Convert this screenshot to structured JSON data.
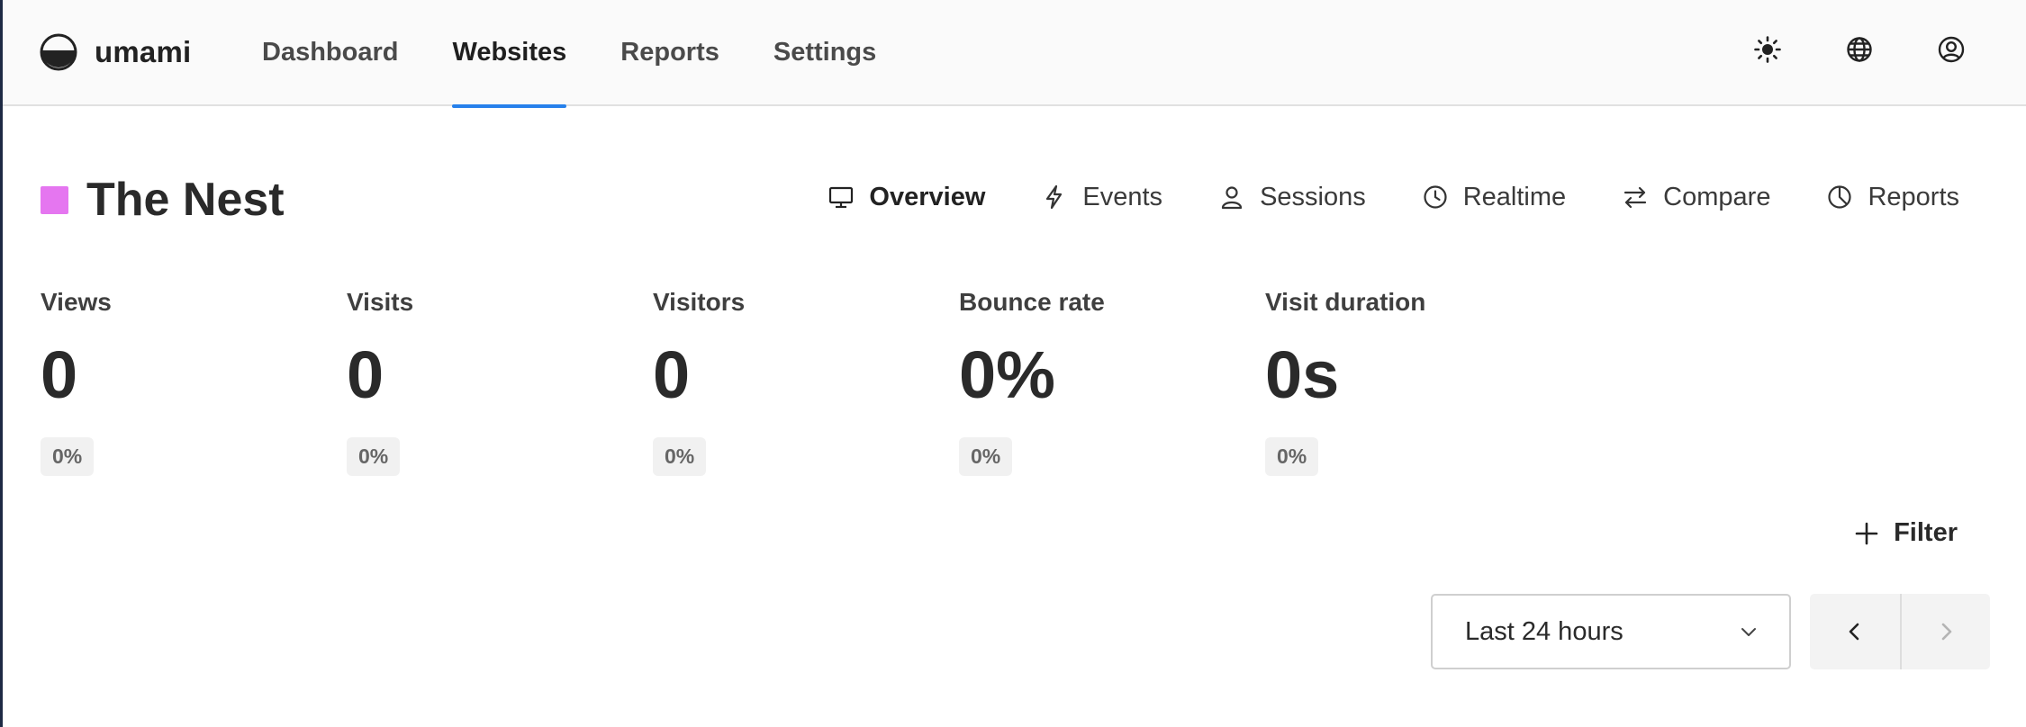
{
  "app": {
    "name": "umami"
  },
  "nav": {
    "items": [
      {
        "label": "Dashboard"
      },
      {
        "label": "Websites"
      },
      {
        "label": "Reports"
      },
      {
        "label": "Settings"
      }
    ],
    "active": "Websites"
  },
  "top_actions": {
    "icons": [
      "theme-sun-icon",
      "language-globe-icon",
      "profile-user-icon"
    ]
  },
  "website": {
    "name": "The Nest",
    "color": "#e576f0"
  },
  "subnav": {
    "items": [
      {
        "label": "Overview",
        "icon": "monitor-icon"
      },
      {
        "label": "Events",
        "icon": "lightning-icon"
      },
      {
        "label": "Sessions",
        "icon": "user-icon"
      },
      {
        "label": "Realtime",
        "icon": "clock-icon"
      },
      {
        "label": "Compare",
        "icon": "arrows-swap-icon"
      },
      {
        "label": "Reports",
        "icon": "pie-chart-icon"
      }
    ],
    "active": "Overview"
  },
  "metrics": [
    {
      "label": "Views",
      "value": "0",
      "change": "0%"
    },
    {
      "label": "Visits",
      "value": "0",
      "change": "0%"
    },
    {
      "label": "Visitors",
      "value": "0",
      "change": "0%"
    },
    {
      "label": "Bounce rate",
      "value": "0%",
      "change": "0%"
    },
    {
      "label": "Visit duration",
      "value": "0s",
      "change": "0%"
    }
  ],
  "filter": {
    "label": "Filter"
  },
  "date_range": {
    "selected": "Last 24 hours"
  },
  "colors": {
    "accent": "#2680eb",
    "text": "#2a2a2a",
    "badge_bg": "#f1f1f1"
  }
}
